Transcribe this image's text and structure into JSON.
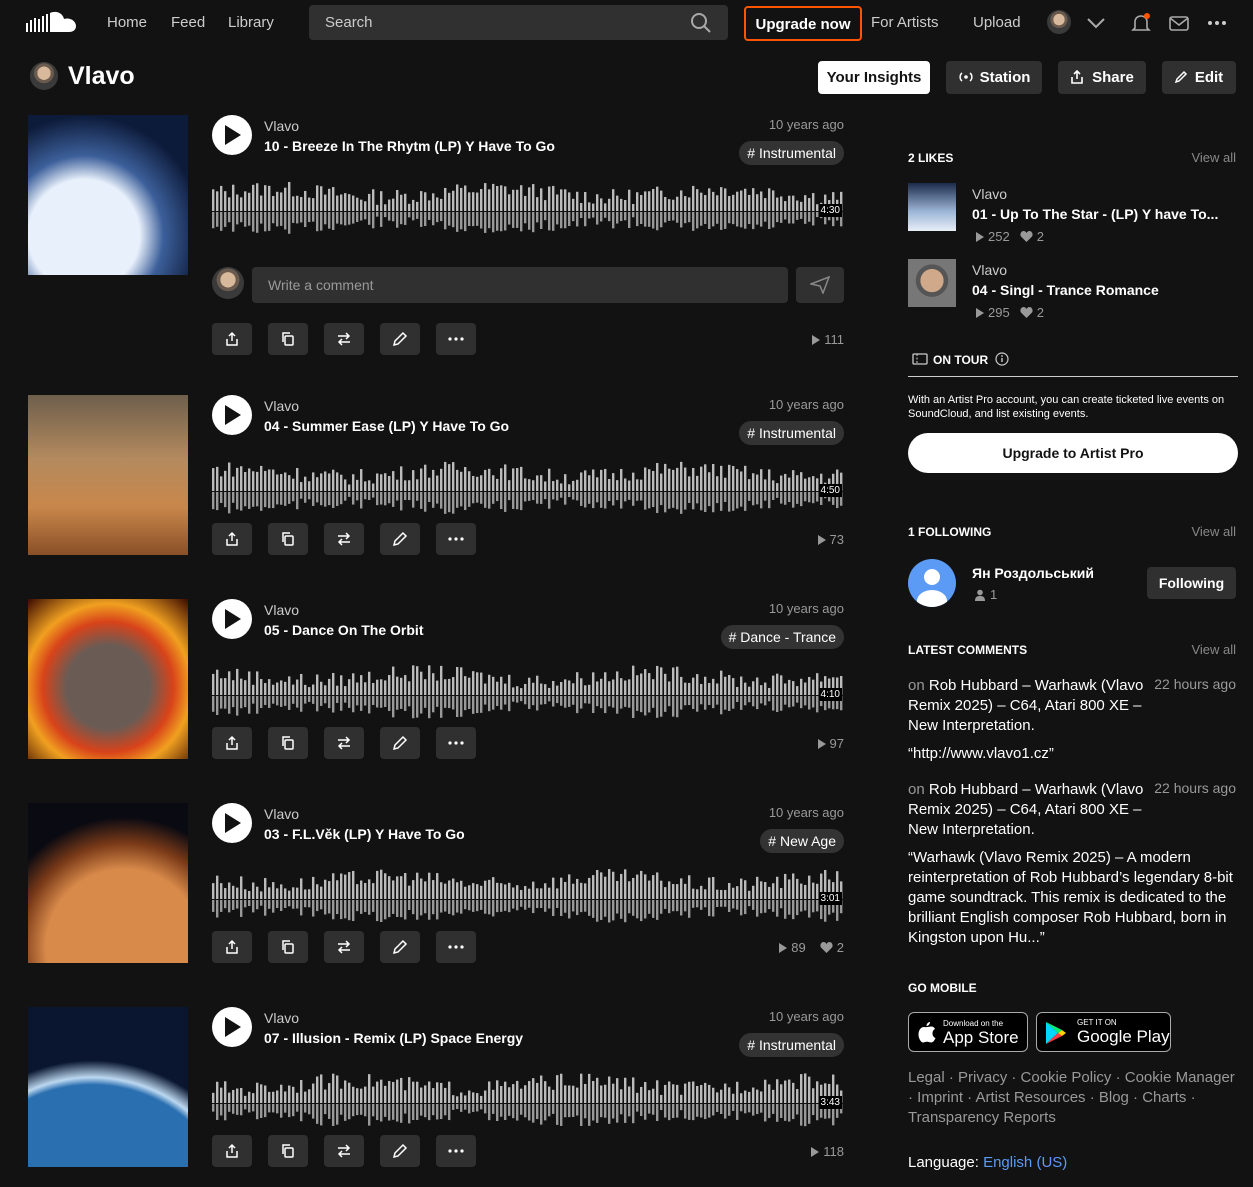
{
  "header": {
    "nav": [
      "Home",
      "Feed",
      "Library"
    ],
    "search_placeholder": "Search",
    "upgrade_label": "Upgrade now",
    "for_artists": "For Artists",
    "upload": "Upload"
  },
  "profile": {
    "name": "Vlavo",
    "buttons": {
      "insights": "Your Insights",
      "station": "Station",
      "share": "Share",
      "edit": "Edit"
    }
  },
  "tracks": [
    {
      "artist": "Vlavo",
      "title": "10 - Breeze In The Rhytm (LP) Y Have To Go",
      "posted": "10 years ago",
      "tag": "# Instrumental",
      "duration": "4:30",
      "plays": "111",
      "likes": ""
    },
    {
      "artist": "Vlavo",
      "title": "04 - Summer Ease (LP) Y Have To Go",
      "posted": "10 years ago",
      "tag": "# Instrumental",
      "duration": "4:50",
      "plays": "73",
      "likes": ""
    },
    {
      "artist": "Vlavo",
      "title": "05 - Dance On The Orbit",
      "posted": "10 years ago",
      "tag": "# Dance - Trance",
      "duration": "4:10",
      "plays": "97",
      "likes": ""
    },
    {
      "artist": "Vlavo",
      "title": "03 - F.L.Věk (LP) Y Have To Go",
      "posted": "10 years ago",
      "tag": "# New Age",
      "duration": "3:01",
      "plays": "89",
      "likes": "2"
    },
    {
      "artist": "Vlavo",
      "title": "07 - Illusion - Remix (LP) Space Energy",
      "posted": "10 years ago",
      "tag": "# Instrumental",
      "duration": "3:43",
      "plays": "118",
      "likes": ""
    }
  ],
  "comment_placeholder": "Write a comment",
  "sidebar": {
    "likes_header": "2 LIKES",
    "view_all": "View all",
    "liked": [
      {
        "artist": "Vlavo",
        "title": "01 - Up To The Star - (LP) Y have To...",
        "plays": "252",
        "likes": "2"
      },
      {
        "artist": "Vlavo",
        "title": "04 - Singl - Trance Romance",
        "plays": "295",
        "likes": "2"
      }
    ],
    "on_tour": "ON TOUR",
    "tour_text": "With an Artist Pro account, you can create ticketed live events on SoundCloud, and list existing events.",
    "artist_pro_btn": "Upgrade to Artist Pro",
    "following_header": "1 FOLLOWING",
    "following_user": "Ян Роздольський",
    "following_count": "1",
    "following_btn": "Following",
    "comments_header": "LATEST COMMENTS",
    "comments": [
      {
        "on": "on",
        "track": "Rob Hubbard – Warhawk (Vlavo Remix 2025) – C64, Atari 800 XE – New Interpretation.",
        "time": "22 hours ago",
        "text": "“http://www.vlavo1.cz”"
      },
      {
        "on": "on",
        "track": "Rob Hubbard – Warhawk (Vlavo Remix 2025) – C64, Atari 800 XE – New Interpretation.",
        "time": "22 hours ago",
        "text": "“Warhawk (Vlavo Remix 2025) – A modern reinterpretation of Rob Hubbard’s legendary 8-bit game soundtrack. This remix is dedicated to the brilliant English composer Rob Hubbard, born in Kingston upon Hu...”"
      }
    ],
    "go_mobile": "GO MOBILE",
    "app_store_small": "Download on the",
    "app_store": "App Store",
    "google_small": "GET IT ON",
    "google_play": "Google Play",
    "footer": "Legal · Privacy · Cookie Policy · Cookie Manager · Imprint · Artist Resources · Blog · Charts · Transparency Reports",
    "language_label": "Language:",
    "language_value": "English (US)"
  },
  "colors": {
    "accent": "#ff5500",
    "background": "#121212",
    "button": "#303030",
    "link": "#5b9bf5"
  }
}
